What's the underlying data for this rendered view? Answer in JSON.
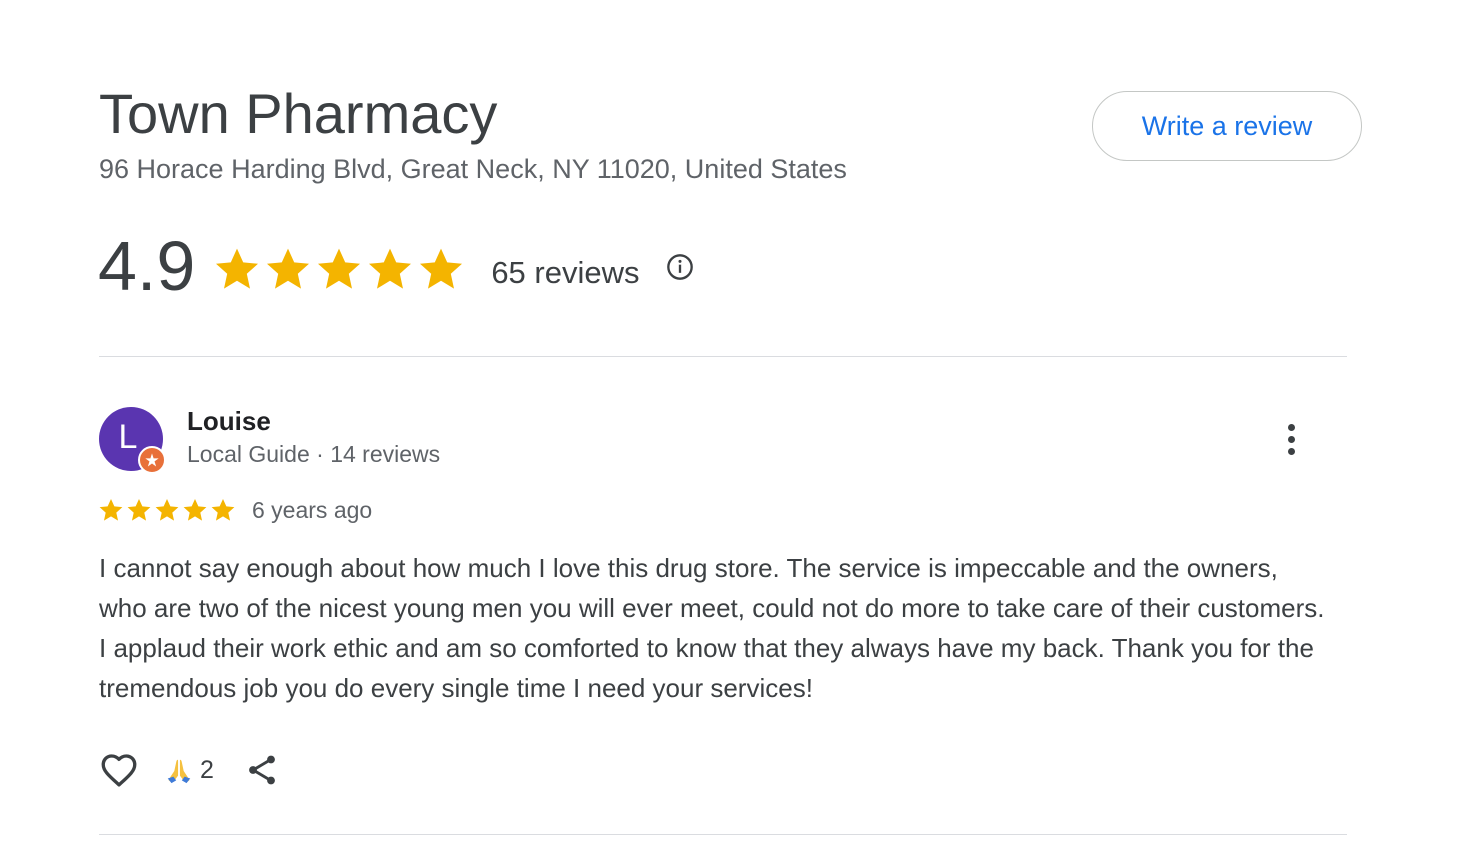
{
  "business": {
    "name": "Town Pharmacy",
    "address": "96 Horace Harding Blvd, Great Neck, NY 11020, United States"
  },
  "write_review_label": "Write a review",
  "summary": {
    "rating": "4.9",
    "stars": 5,
    "review_count": "65 reviews",
    "star_color": "#f4b400",
    "info_icon": "info-circle-icon"
  },
  "review": {
    "avatar_letter": "L",
    "avatar_color": "#5a35b0",
    "badge_icon": "local-guide-star-icon",
    "reviewer_name": "Louise",
    "reviewer_meta": "Local Guide · 14 reviews",
    "more_icon": "more-vertical-icon",
    "stars": 5,
    "date": "6 years ago",
    "text": "I cannot say enough about how much I love this drug store. The service is impeccable and the owners, who are two of the nicest young men you will ever meet, could not do more to take care of their customers. I applaud their work ethic and am so comforted to know that they always have my back. Thank you for the tremendous job you do every single time I need your services!",
    "like_icon": "heart-icon",
    "reaction_icon": "folded-hands-icon",
    "reaction_count": "2",
    "share_icon": "share-icon"
  },
  "accent_color": "#1a73e8"
}
